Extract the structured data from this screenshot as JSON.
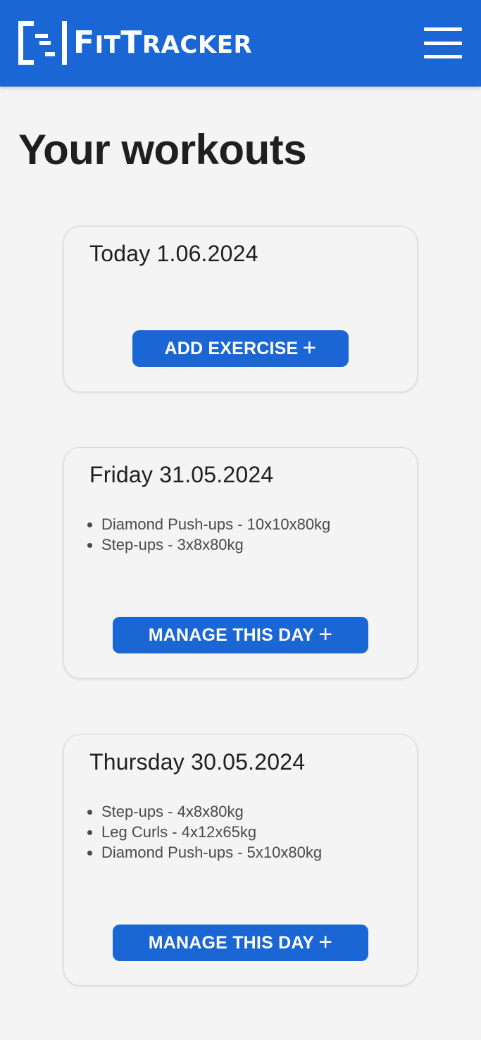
{
  "header": {
    "logo_big_1": "F",
    "logo_small_1": "IT",
    "logo_big_2": "T",
    "logo_small_2": "RACKER",
    "menu_icon": "hamburger-menu-icon",
    "background_color": "#1a66d4"
  },
  "page": {
    "title": "Your workouts"
  },
  "workouts": [
    {
      "title": "Today 1.06.2024",
      "exercises": [],
      "button_label": "ADD EXERCISE",
      "button_icon": "+"
    },
    {
      "title": "Friday 31.05.2024",
      "exercises": [
        "Diamond Push-ups - 10x10x80kg",
        "Step-ups - 3x8x80kg"
      ],
      "button_label": "MANAGE THIS DAY",
      "button_icon": "+"
    },
    {
      "title": "Thursday 30.05.2024",
      "exercises": [
        "Step-ups - 4x8x80kg",
        "Leg Curls - 4x12x65kg",
        "Diamond Push-ups - 5x10x80kg"
      ],
      "button_label": "MANAGE THIS DAY",
      "button_icon": "+"
    }
  ],
  "colors": {
    "accent": "#1a66d4",
    "background": "#f4f4f4"
  }
}
